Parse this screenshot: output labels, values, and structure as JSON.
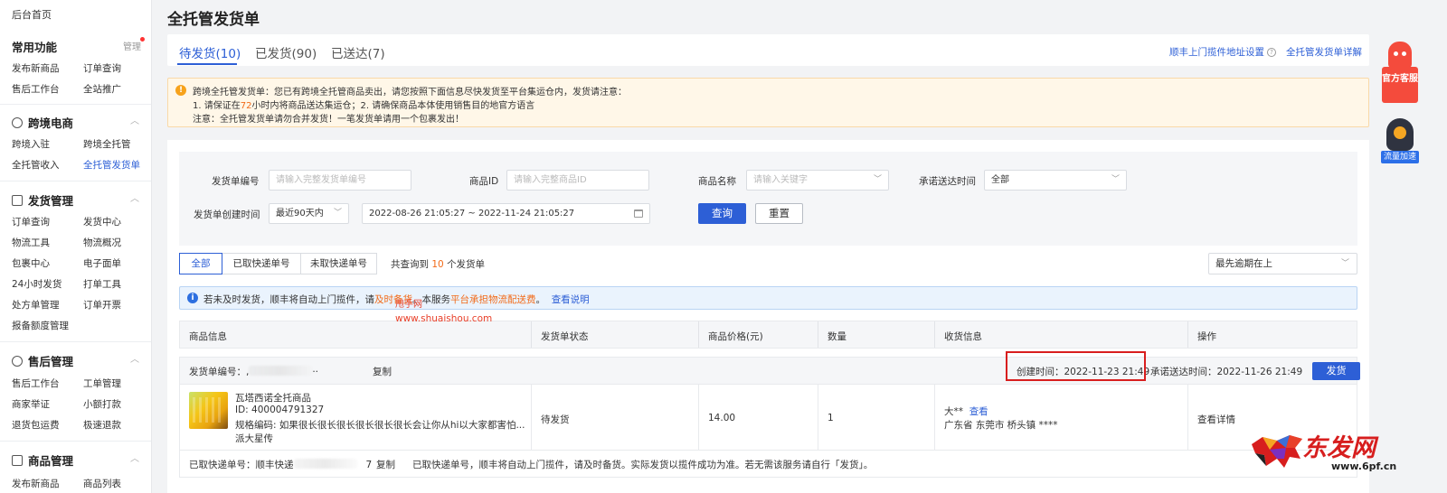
{
  "sidebar": {
    "home": "后台首页",
    "common": {
      "title": "常用功能",
      "manage": "管理",
      "items": [
        "发布新商品",
        "订单查询",
        "售后工作台",
        "全站推广"
      ]
    },
    "cross_border": {
      "title": "跨境电商",
      "items": [
        "跨境入驻",
        "跨境全托管",
        "全托管收入",
        "全托管发货单"
      ],
      "active": "全托管发货单"
    },
    "shipping": {
      "title": "发货管理",
      "items": [
        "订单查询",
        "发货中心",
        "物流工具",
        "物流概况",
        "包裹中心",
        "电子面单",
        "24小时发货",
        "打单工具",
        "处方单管理",
        "订单开票",
        "报备额度管理"
      ]
    },
    "after_sales": {
      "title": "售后管理",
      "items": [
        "售后工作台",
        "工单管理",
        "商家举证",
        "小额打款",
        "退货包运费",
        "极速退款"
      ]
    },
    "goods": {
      "title": "商品管理",
      "items": [
        "发布新商品",
        "商品列表"
      ]
    }
  },
  "page": {
    "title": "全托管发货单"
  },
  "tabs": [
    {
      "label": "待发货(10)",
      "active": true
    },
    {
      "label": "已发货(90)",
      "active": false
    },
    {
      "label": "已送达(7)",
      "active": false
    }
  ],
  "top_links": {
    "sf_address": "顺丰上门揽件地址设置",
    "detail": "全托管发货单详解"
  },
  "notice": {
    "line1": "跨境全托管发货单：您已有跨境全托管商品卖出，请您按照下面信息尽快发货至平台集运仓内，发货请注意：",
    "line2_a": "1. 请保证在",
    "line2_hours": "72",
    "line2_b": "小时内将商品送达集运仓；2. 请确保商品本体使用销售目的地官方语言",
    "line3": "注意：全托管发货单请勿合并发货！一笔发货单请用一个包裹发出！"
  },
  "filters": {
    "order_no_label": "发货单编号",
    "order_no_placeholder": "请输入完整发货单编号",
    "product_id_label": "商品ID",
    "product_id_placeholder": "请输入完整商品ID",
    "product_name_label": "商品名称",
    "product_name_placeholder": "请输入关键字",
    "promise_time_label": "承诺送达时间",
    "promise_time_value": "全部",
    "create_time_label": "发货单创建时间",
    "create_range_value": "最近90天内",
    "date_range": "2022-08-26 21:05:27 ~ 2022-11-24 21:05:27",
    "search_button": "查询",
    "reset_button": "重置"
  },
  "segments": [
    "全部",
    "已取快递单号",
    "未取快递单号"
  ],
  "total": {
    "prefix": "共查询到",
    "count": "10",
    "suffix": "个发货单"
  },
  "sort_value": "最先逾期在上",
  "info_bar": {
    "a": "若未及时发货，顺丰将自动上门揽件，请",
    "b": "及时备货",
    "c": "。本服务",
    "d": "平台承担物流配送费",
    "e": "。",
    "link": "查看说明"
  },
  "watermark": {
    "cn": "甩手网",
    "url": "www.shuaishou.com"
  },
  "table": {
    "headers": [
      "商品信息",
      "发货单状态",
      "商品价格(元)",
      "数量",
      "收货信息",
      "操作"
    ]
  },
  "order": {
    "no_label": "发货单编号：",
    "no_fragment_a": ",",
    "no_fragment_b": "··",
    "copy": "复制",
    "created_label": "创建时间：",
    "created_value": "2022-11-23 21:49",
    "promise_label": "承诺送达时间：",
    "promise_value": "2022-11-26 21:49",
    "ship_button": "发货",
    "product_name": "瓦塔西诺全托商品",
    "product_id": "ID: 400004791327",
    "spec": "规格编码: 如果很长很长很长很长很长很长会让你从hi以大家都害怕...",
    "spec2": "派大星传",
    "status": "待发货",
    "price": "14.00",
    "qty": "1",
    "receiver_name": "大**",
    "receiver_view": "查看",
    "receiver_addr": "广东省 东莞市 桥头镇 ****",
    "action": "查看详情",
    "express_label": "已取快递单号：",
    "express_company": "顺丰快递",
    "express_tail": "7",
    "express_copy": "复制",
    "express_note": "已取快递单号，顺丰将自动上门揽件，请及时备货。实际发货以揽件成功为准。若无需该服务请自行「发货」。"
  },
  "floating": {
    "service": "官方客服",
    "traffic": "流量加速"
  },
  "logo": {
    "text": "东发网",
    "url": "www.6pf.cn"
  },
  "colors": {
    "primary": "#2d5fd6",
    "warning": "#f26a18",
    "highlight_border": "#d81e1e"
  }
}
